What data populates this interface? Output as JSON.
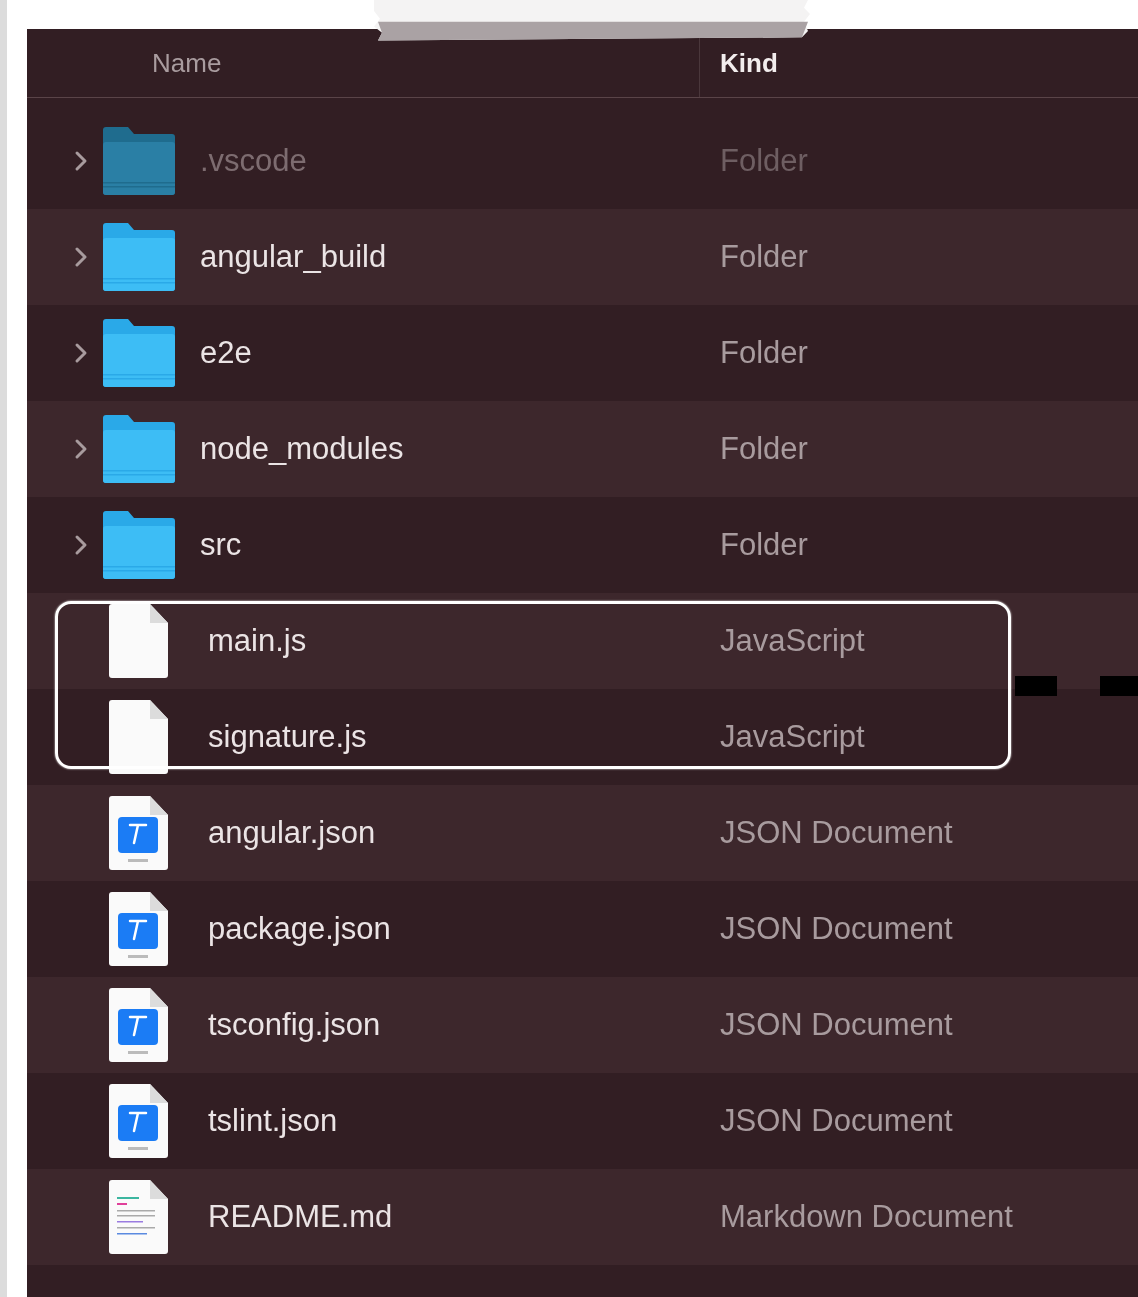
{
  "columns": [
    {
      "label": "Name",
      "selected": false
    },
    {
      "label": "Kind",
      "selected": true
    }
  ],
  "rows": [
    {
      "name": ".vscode",
      "kind_text": "Folder",
      "kind": "folder",
      "hidden": true,
      "circled": false
    },
    {
      "name": "angular_build",
      "kind_text": "Folder",
      "kind": "folder",
      "hidden": false,
      "circled": false
    },
    {
      "name": "e2e",
      "kind_text": "Folder",
      "kind": "folder",
      "hidden": false,
      "circled": false
    },
    {
      "name": "node_modules",
      "kind_text": "Folder",
      "kind": "folder",
      "hidden": false,
      "circled": false
    },
    {
      "name": "src",
      "kind_text": "Folder",
      "kind": "folder",
      "hidden": false,
      "circled": false
    },
    {
      "name": "main.js",
      "kind_text": "JavaScript",
      "kind": "plain",
      "hidden": false,
      "circled": true
    },
    {
      "name": "signature.js",
      "kind_text": "JavaScript",
      "kind": "plain",
      "hidden": false,
      "circled": true
    },
    {
      "name": "angular.json",
      "kind_text": "JSON Document",
      "kind": "json",
      "hidden": false,
      "circled": false
    },
    {
      "name": "package.json",
      "kind_text": "JSON Document",
      "kind": "json",
      "hidden": false,
      "circled": false
    },
    {
      "name": "tsconfig.json",
      "kind_text": "JSON Document",
      "kind": "json",
      "hidden": false,
      "circled": false
    },
    {
      "name": "tslint.json",
      "kind_text": "JSON Document",
      "kind": "json",
      "hidden": false,
      "circled": false
    },
    {
      "name": "README.md",
      "kind_text": "Markdown Document",
      "kind": "markdown",
      "hidden": false,
      "circled": false
    }
  ]
}
